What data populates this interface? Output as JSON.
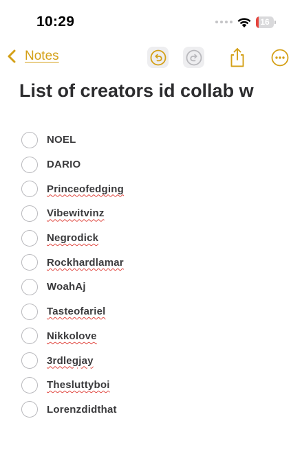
{
  "status_bar": {
    "time": "10:29",
    "battery": "16",
    "battery_level": 0.16,
    "icons": [
      "signal-dots-icon",
      "wifi-icon",
      "battery-icon"
    ]
  },
  "nav": {
    "back_label": "Notes",
    "accent_color": "#d4a017",
    "icons": [
      "chevron-left-icon",
      "undo-icon",
      "redo-icon",
      "share-icon",
      "more-icon"
    ]
  },
  "note": {
    "title": "List of creators id collab w",
    "items": [
      {
        "label": "NOEL",
        "misspelled": false
      },
      {
        "label": "DARIO",
        "misspelled": false
      },
      {
        "label": "Princeofedging",
        "misspelled": true
      },
      {
        "label": "Vibewitvinz",
        "misspelled": true
      },
      {
        "label": "Negrodick",
        "misspelled": true
      },
      {
        "label": "Rockhardlamar",
        "misspelled": true
      },
      {
        "label": "WoahAj",
        "misspelled": false
      },
      {
        "label": "Tasteofariel",
        "misspelled": true
      },
      {
        "label": "Nikkolove",
        "misspelled": true
      },
      {
        "label": "3rdlegjay",
        "misspelled": true
      },
      {
        "label": "Thesluttyboi",
        "misspelled": true
      },
      {
        "label": "Lorenzdidthat",
        "misspelled": false
      }
    ]
  }
}
